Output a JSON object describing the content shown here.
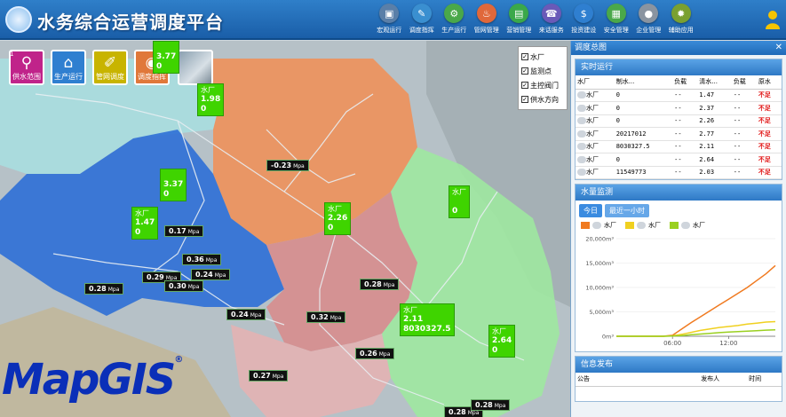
{
  "header": {
    "title": "水务综合运营调度平台",
    "nav": [
      {
        "label": "宏观运行",
        "icon": "monitor-icon",
        "color": "#5a7fa8"
      },
      {
        "label": "调度指挥",
        "icon": "command-icon",
        "color": "#3a8fd0"
      },
      {
        "label": "生产运行",
        "icon": "production-icon",
        "color": "#4aa84a"
      },
      {
        "label": "管网管理",
        "icon": "pipe-network-icon",
        "color": "#e0683a"
      },
      {
        "label": "营销管理",
        "icon": "marketing-icon",
        "color": "#3aa84a"
      },
      {
        "label": "来话服务",
        "icon": "service-icon",
        "color": "#6a5ab8"
      },
      {
        "label": "投资建设",
        "icon": "investment-icon",
        "color": "#2f7fd0"
      },
      {
        "label": "安全管理",
        "icon": "safety-icon",
        "color": "#4aa84a"
      },
      {
        "label": "企业管理",
        "icon": "enterprise-icon",
        "color": "#8a94a0"
      },
      {
        "label": "辅助应用",
        "icon": "gear-icon",
        "color": "#7aa030"
      }
    ]
  },
  "map": {
    "tools": [
      {
        "label": "供水范围",
        "icon": "water-tap-icon",
        "color": "#c0238a"
      },
      {
        "label": "生产运行",
        "icon": "house-icon",
        "color": "#2f7fd0"
      },
      {
        "label": "管网调度",
        "icon": "brush-icon",
        "color": "#c8b400"
      },
      {
        "label": "调度指挥",
        "icon": "eye-icon",
        "color": "#e0783a"
      }
    ],
    "tool_badge": "1",
    "layers": [
      "水厂",
      "监测点",
      "主控阀门",
      "供水方向"
    ],
    "flows": [
      "-0.23",
      "0.17",
      "0.36",
      "0.29",
      "0.30",
      "0.24",
      "0.28",
      "0.24",
      "0.32",
      "0.28",
      "0.27",
      "0.26",
      "0.28",
      "0.28"
    ],
    "flow_unit": "Mpa",
    "plants": [
      {
        "name": "",
        "v1": "3.77",
        "v2": "0"
      },
      {
        "name": "水厂",
        "v1": "1.98",
        "v2": "0"
      },
      {
        "name": "",
        "v1": "3.37",
        "v2": "0"
      },
      {
        "name": "水厂",
        "v1": "1.47",
        "v2": "0"
      },
      {
        "name": "水厂",
        "v1": "2.26",
        "v2": "0"
      },
      {
        "name": "水厂",
        "v1": "",
        "v2": "0"
      },
      {
        "name": "水厂",
        "v1": "2.11",
        "v2": "8030327.5"
      },
      {
        "name": "水厂",
        "v1": "2.64",
        "v2": "0"
      }
    ],
    "watermark": "MapGIS"
  },
  "panel": {
    "title": "调度总图",
    "realtime": {
      "title": "实时运行",
      "columns": [
        "水厂",
        "制水...",
        "负载",
        "清水...",
        "负载",
        "原水"
      ],
      "rows": [
        {
          "c1": "0",
          "c2": "--",
          "c3": "1.47",
          "c4": "--",
          "st": "不足"
        },
        {
          "c1": "0",
          "c2": "--",
          "c3": "2.37",
          "c4": "--",
          "st": "不足"
        },
        {
          "c1": "0",
          "c2": "--",
          "c3": "2.26",
          "c4": "--",
          "st": "不足"
        },
        {
          "c1": "20217012",
          "c2": "--",
          "c3": "2.77",
          "c4": "--",
          "st": "不足"
        },
        {
          "c1": "8030327.5",
          "c2": "--",
          "c3": "2.11",
          "c4": "--",
          "st": "不足"
        },
        {
          "c1": "0",
          "c2": "--",
          "c3": "2.64",
          "c4": "--",
          "st": "不足"
        },
        {
          "c1": "11549773",
          "c2": "--",
          "c3": "2.03",
          "c4": "--",
          "st": "不足"
        }
      ]
    },
    "monitor": {
      "title": "水量监测",
      "tabs": [
        "今日",
        "最近一小时"
      ],
      "legend": [
        {
          "name": "水厂",
          "color": "#f07a20"
        },
        {
          "name": "水厂",
          "color": "#f0d020"
        },
        {
          "name": "水厂",
          "color": "#9ad020"
        }
      ]
    },
    "info": {
      "title": "信息发布",
      "columns": [
        "公告",
        "发布人",
        "时间"
      ]
    }
  },
  "chart_data": {
    "type": "line",
    "x": [
      "00:00",
      "01:00",
      "02:00",
      "03:00",
      "04:00",
      "05:00",
      "06:00",
      "07:00",
      "08:00",
      "09:00",
      "10:00",
      "11:00",
      "12:00",
      "13:00",
      "14:00",
      "15:00",
      "16:00",
      "17:00"
    ],
    "xticks": [
      "06:00",
      "12:00"
    ],
    "yticks": [
      "0m³",
      "5,000m³",
      "10,000m³",
      "15,000m³",
      "20,000m³"
    ],
    "ylim": [
      0,
      20000
    ],
    "series": [
      {
        "name": "水厂",
        "color": "#f07a20",
        "values": [
          0,
          0,
          0,
          0,
          0,
          0,
          200,
          1500,
          2800,
          4000,
          5200,
          6400,
          7600,
          8800,
          10000,
          11400,
          12800,
          14500
        ]
      },
      {
        "name": "水厂",
        "color": "#f0d020",
        "values": [
          0,
          0,
          0,
          0,
          0,
          0,
          100,
          400,
          800,
          1200,
          1500,
          1800,
          2000,
          2200,
          2500,
          2700,
          2900,
          3000
        ]
      },
      {
        "name": "水厂",
        "color": "#9ad020",
        "values": [
          0,
          0,
          0,
          0,
          0,
          0,
          50,
          150,
          300,
          450,
          600,
          750,
          850,
          950,
          1050,
          1150,
          1250,
          1300
        ]
      }
    ]
  }
}
